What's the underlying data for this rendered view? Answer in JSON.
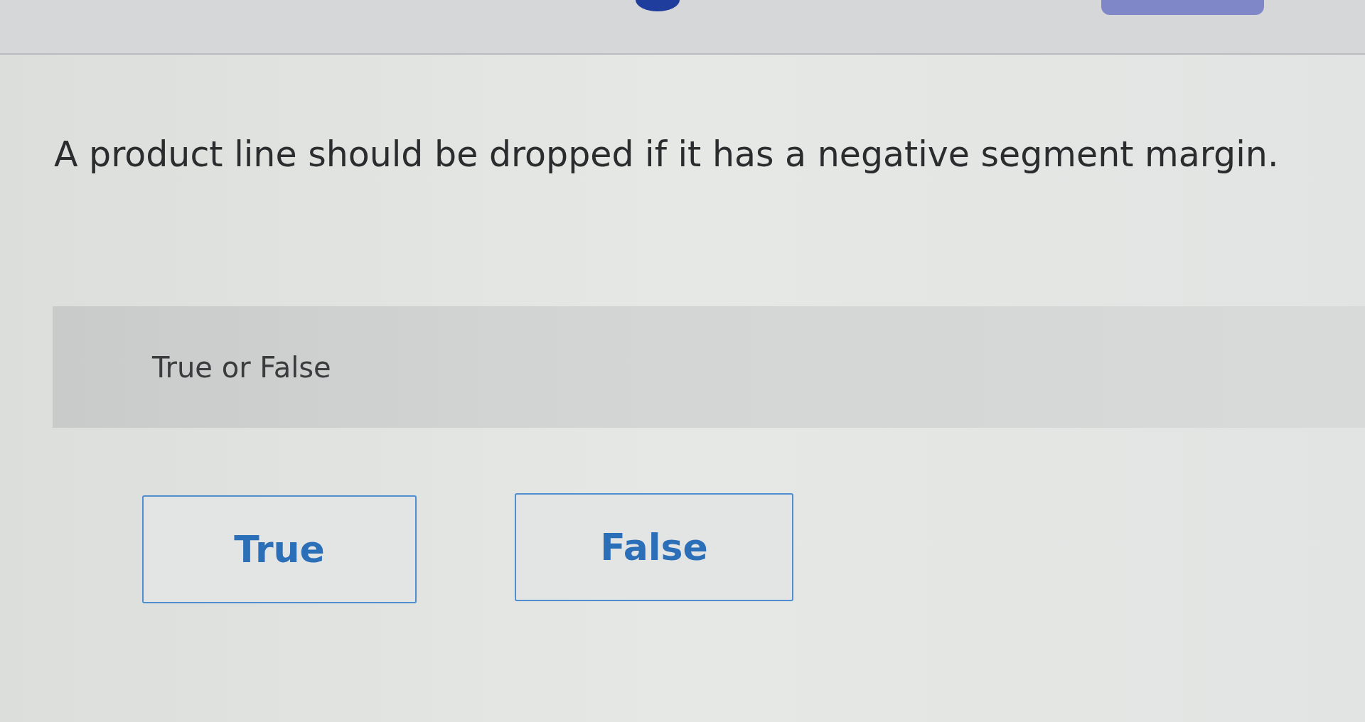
{
  "question": {
    "text": "A product line should be dropped if it has a negative segment margin."
  },
  "answer_type": {
    "label": "True or False"
  },
  "options": [
    {
      "label": "True",
      "selected": false
    },
    {
      "label": "False",
      "selected": false
    }
  ]
}
